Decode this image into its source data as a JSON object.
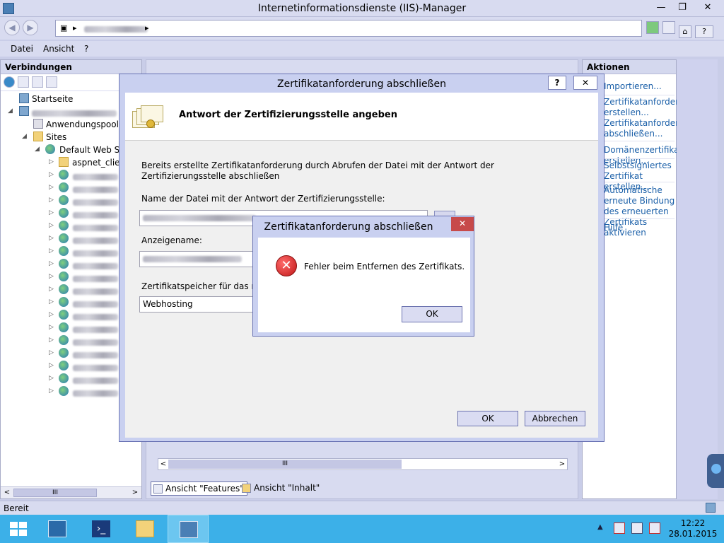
{
  "window": {
    "title": "Internetinformationsdienste (IIS)-Manager",
    "minimize": "—",
    "maximize": "❐",
    "close": "✕"
  },
  "address": {
    "sep1": "▸",
    "sep2": "▸"
  },
  "menu": {
    "items": [
      "Datei",
      "Ansicht",
      "?"
    ]
  },
  "left_panel": {
    "title": "Verbindungen",
    "tree": {
      "startseite": "Startseite",
      "anwendungspools": "Anwendungspools",
      "sites": "Sites",
      "default_web_site": "Default Web Site",
      "aspnet_client": "aspnet_client"
    },
    "scroll_label": "III",
    "scroll_left": "<",
    "scroll_right": ">"
  },
  "center": {
    "scroll_label": "III",
    "scroll_left": "<",
    "scroll_right": ">",
    "tab_features": "Ansicht \"Features\"",
    "tab_content": "Ansicht \"Inhalt\""
  },
  "actions": {
    "title": "Aktionen",
    "items": [
      "Importieren...",
      "Zertifikatanforderung erstellen...",
      "Zertifikatanforderung abschließen...",
      "Domänenzertifikat erstellen...",
      "Selbstsigniertes Zertifikat erstellen...",
      "Automatische erneute Bindung des erneuerten Zertifikats aktivieren",
      "Hilfe"
    ]
  },
  "status": {
    "text": "Bereit"
  },
  "dialog": {
    "title": "Zertifikatanforderung abschließen",
    "help": "?",
    "close": "✕",
    "header": "Antwort der Zertifizierungsstelle angeben",
    "description": "Bereits erstellte Zertifikatanforderung durch Abrufen der Datei mit der Antwort der Zertifizierungsstelle abschließen",
    "file_label": "Name der Datei mit der Antwort der Zertifizierungsstelle:",
    "display_label": "Anzeigename:",
    "store_label": "Zertifikatspeicher für das neue",
    "store_value": "Webhosting",
    "ok": "OK",
    "cancel": "Abbrechen"
  },
  "error_dialog": {
    "title": "Zertifikatanforderung abschließen",
    "close": "✕",
    "icon": "✕",
    "message": "Fehler beim Entfernen des Zertifikats.",
    "ok": "OK"
  },
  "taskbar": {
    "tray_arrow": "▲",
    "time": "12:22",
    "date": "28.01.2015"
  }
}
